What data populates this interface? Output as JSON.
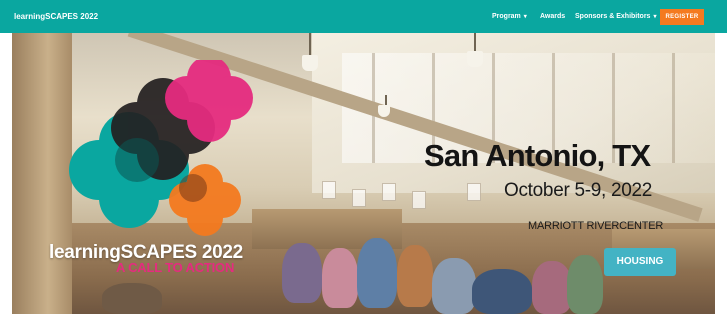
{
  "navbar": {
    "brand": "learningSCAPES 2022",
    "items": [
      {
        "label": "Program",
        "has_dropdown": true
      },
      {
        "label": "Awards",
        "has_dropdown": false
      },
      {
        "label": "Sponsors & Exhibitors",
        "has_dropdown": true
      }
    ],
    "caret": "▾",
    "register_label": "REGISTER"
  },
  "hero": {
    "logo_text": "learningSCAPES 2022",
    "tagline": "A CALL TO ACTION",
    "city": "San Antonio, TX",
    "dates": "October 5-9, 2022",
    "venue": "MARRIOTT RIVERCENTER",
    "housing_label": "HOUSING"
  },
  "colors": {
    "navbar_bg": "#0aa7a0",
    "register_bg": "#f47a1f",
    "housing_bg": "#43b3c4",
    "logo_teal": "#0aa7a0",
    "logo_dark": "#231f20",
    "logo_pink": "#e52b7f",
    "logo_orange": "#f47a1f"
  }
}
